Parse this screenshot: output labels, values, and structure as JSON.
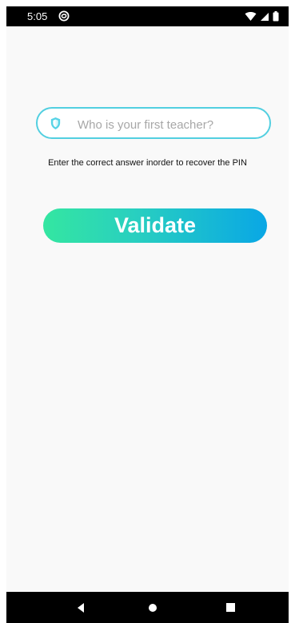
{
  "status_bar": {
    "time": "5:05",
    "icons": [
      "sync-icon",
      "wifi-icon",
      "signal-icon",
      "battery-icon"
    ]
  },
  "security_question": {
    "placeholder": "Who is your first teacher?",
    "value": "",
    "icon": "shield-icon",
    "helper_text": "Enter the correct answer inorder to recover the PIN"
  },
  "validate_button": {
    "label": "Validate"
  },
  "navigation": {
    "icons": [
      "back-icon",
      "home-icon",
      "recents-icon"
    ]
  },
  "colors": {
    "input_border": "#52cfe0",
    "button_start": "#34e6a1",
    "button_end": "#09a7e5",
    "status_bar": "#000000",
    "background": "#f9f9f9"
  }
}
